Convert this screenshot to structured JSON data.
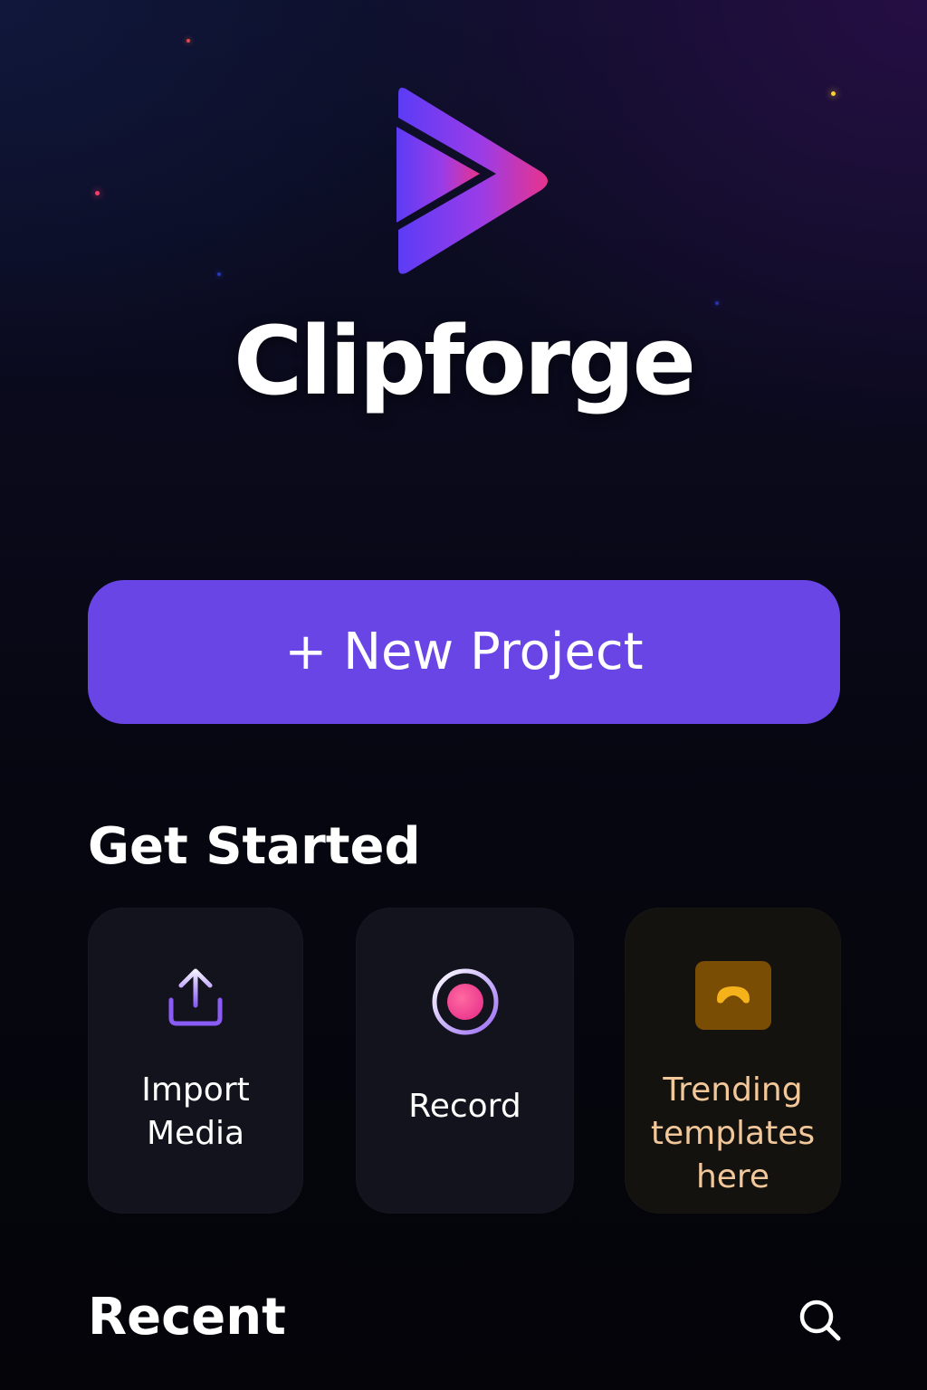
{
  "app": {
    "title": "Clipforge"
  },
  "actions": {
    "new_project_label": "+ New Project"
  },
  "get_started": {
    "title": "Get Started",
    "cards": [
      {
        "label_line1": "Import",
        "label_line2": "Media",
        "icon": "upload-icon"
      },
      {
        "label": "Record",
        "icon": "record-icon"
      },
      {
        "label_line1": "Trending",
        "label_line2": "templates",
        "label_line3": "here",
        "icon": "templates-icon"
      }
    ]
  },
  "recent": {
    "title": "Recent",
    "search_icon": "search-icon"
  },
  "colors": {
    "accent": "#6a45e6",
    "trending_text": "#f2c79a",
    "trending_icon_bg": "#7a4d04",
    "trending_icon_fg": "#f5b21a"
  }
}
